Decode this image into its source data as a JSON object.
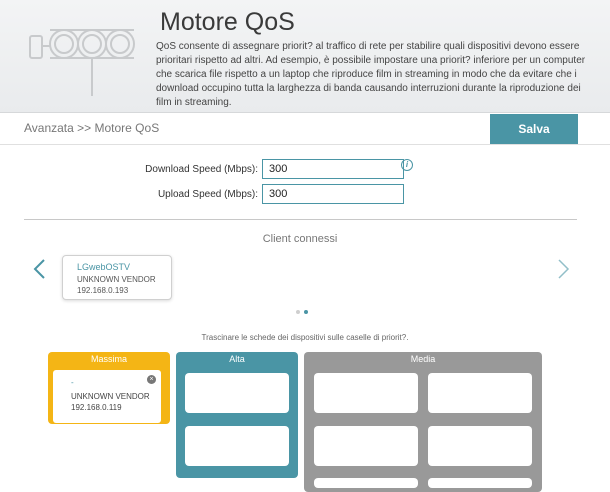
{
  "header": {
    "title": "Motore QoS",
    "description": "QoS consente di assegnare priorit? al traffico di rete per stabilire quali dispositivi devono essere prioritari rispetto ad altri. Ad esempio, è possibile impostare una priorit? inferiore per un computer che scarica file rispetto a un laptop che riproduce film in streaming in modo che da evitare che i download occupino tutta la larghezza di banda causando interruzioni durante la riproduzione dei film in streaming."
  },
  "breadcrumb": "Avanzata >> Motore QoS",
  "toolbar": {
    "save_label": "Salva"
  },
  "form": {
    "download_label": "Download Speed (Mbps):",
    "download_value": "300",
    "upload_label": "Upload Speed (Mbps):",
    "upload_value": "300",
    "info_icon": "info-icon"
  },
  "clients": {
    "title": "Client connessi",
    "items": [
      {
        "name": "LGwebOSTV",
        "vendor": "UNKNOWN VENDOR",
        "ip": "192.168.0.193"
      }
    ]
  },
  "hint": "Trascinare le schede dei dispositivi sulle caselle di priorit?.",
  "priority": {
    "max": {
      "title": "Massima",
      "device": {
        "name": "-",
        "vendor": "UNKNOWN VENDOR",
        "ip": "192.168.0.119"
      }
    },
    "high": {
      "title": "Alta"
    },
    "medium": {
      "title": "Media"
    }
  },
  "colors": {
    "accent": "#4a95a5",
    "max": "#f4b515",
    "high": "#4a95a5",
    "medium": "#999999"
  }
}
